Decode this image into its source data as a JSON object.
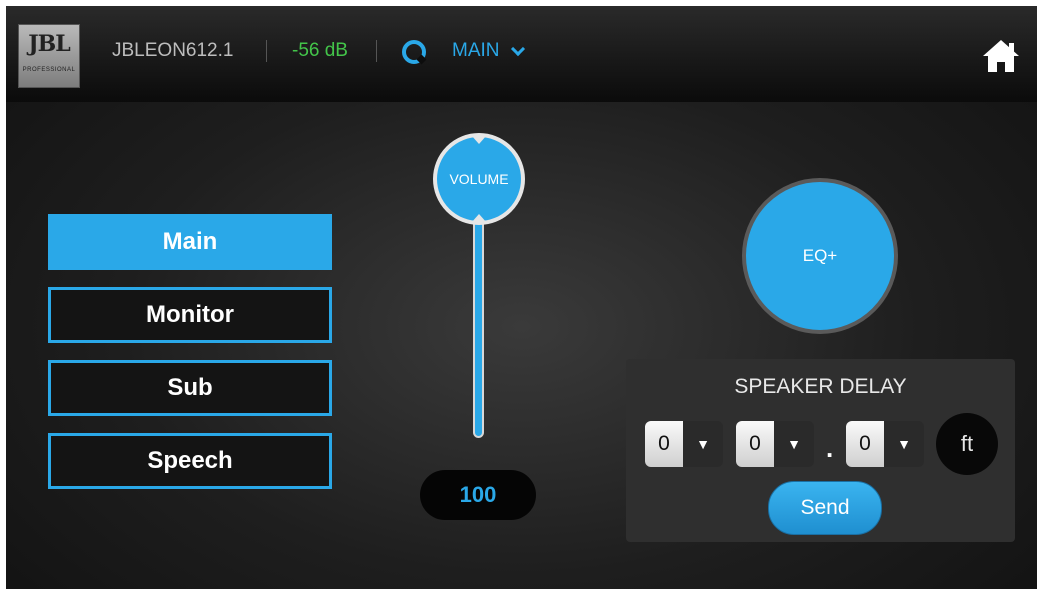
{
  "header": {
    "logo_text": "JBL",
    "logo_subtext": "PROFESSIONAL",
    "device_name": "JBLEON612.1",
    "level": "-56 dB",
    "mode": "MAIN"
  },
  "presets": [
    {
      "label": "Main",
      "active": true
    },
    {
      "label": "Monitor",
      "active": false
    },
    {
      "label": "Sub",
      "active": false
    },
    {
      "label": "Speech",
      "active": false
    }
  ],
  "volume": {
    "knob_label": "VOLUME",
    "value": "100"
  },
  "eq": {
    "label": "EQ+"
  },
  "speaker_delay": {
    "title": "SPEAKER DELAY",
    "digits": [
      "0",
      "0",
      "0"
    ],
    "separator": ".",
    "unit": "ft",
    "send_label": "Send"
  },
  "colors": {
    "accent": "#2aa8e8",
    "level_green": "#43c54a"
  },
  "icons": [
    "home-icon",
    "signal-ring-icon",
    "chevron-down-icon",
    "dropdown-arrow-icon"
  ]
}
